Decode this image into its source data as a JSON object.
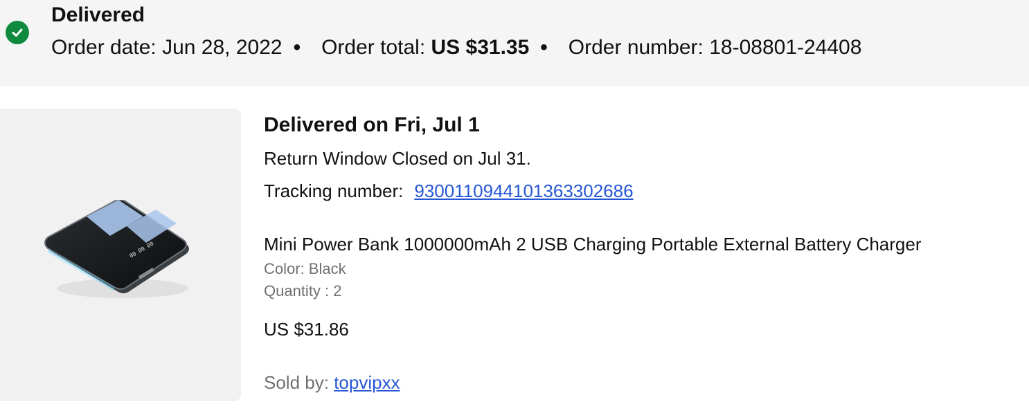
{
  "order_header": {
    "status": "Delivered",
    "status_color": "#0f8a3e",
    "order_date_label": "Order date:",
    "order_date": "Jun 28, 2022",
    "order_total_label": "Order total:",
    "order_total": "US $31.35",
    "order_number_label": "Order number:",
    "order_number": "18-08801-24408",
    "separator": "•",
    "icon": "check-circle-icon"
  },
  "shipment": {
    "delivered_on": "Delivered on Fri, Jul 1",
    "return_window": "Return Window Closed on Jul 31.",
    "tracking_label": "Tracking number:",
    "tracking_number": "9300110944101363302686"
  },
  "item": {
    "image": "power-bank-image",
    "title": "Mini Power Bank 1000000mAh 2 USB Charging Portable External Battery Charger",
    "color": "Color: Black",
    "quantity": "Quantity : 2",
    "price": "US $31.86",
    "seller_label": "Sold by:",
    "seller": "topvipxx"
  },
  "colors": {
    "link": "#2556d6",
    "header_bg": "#f5f5f5",
    "secondary_text": "#707070"
  }
}
